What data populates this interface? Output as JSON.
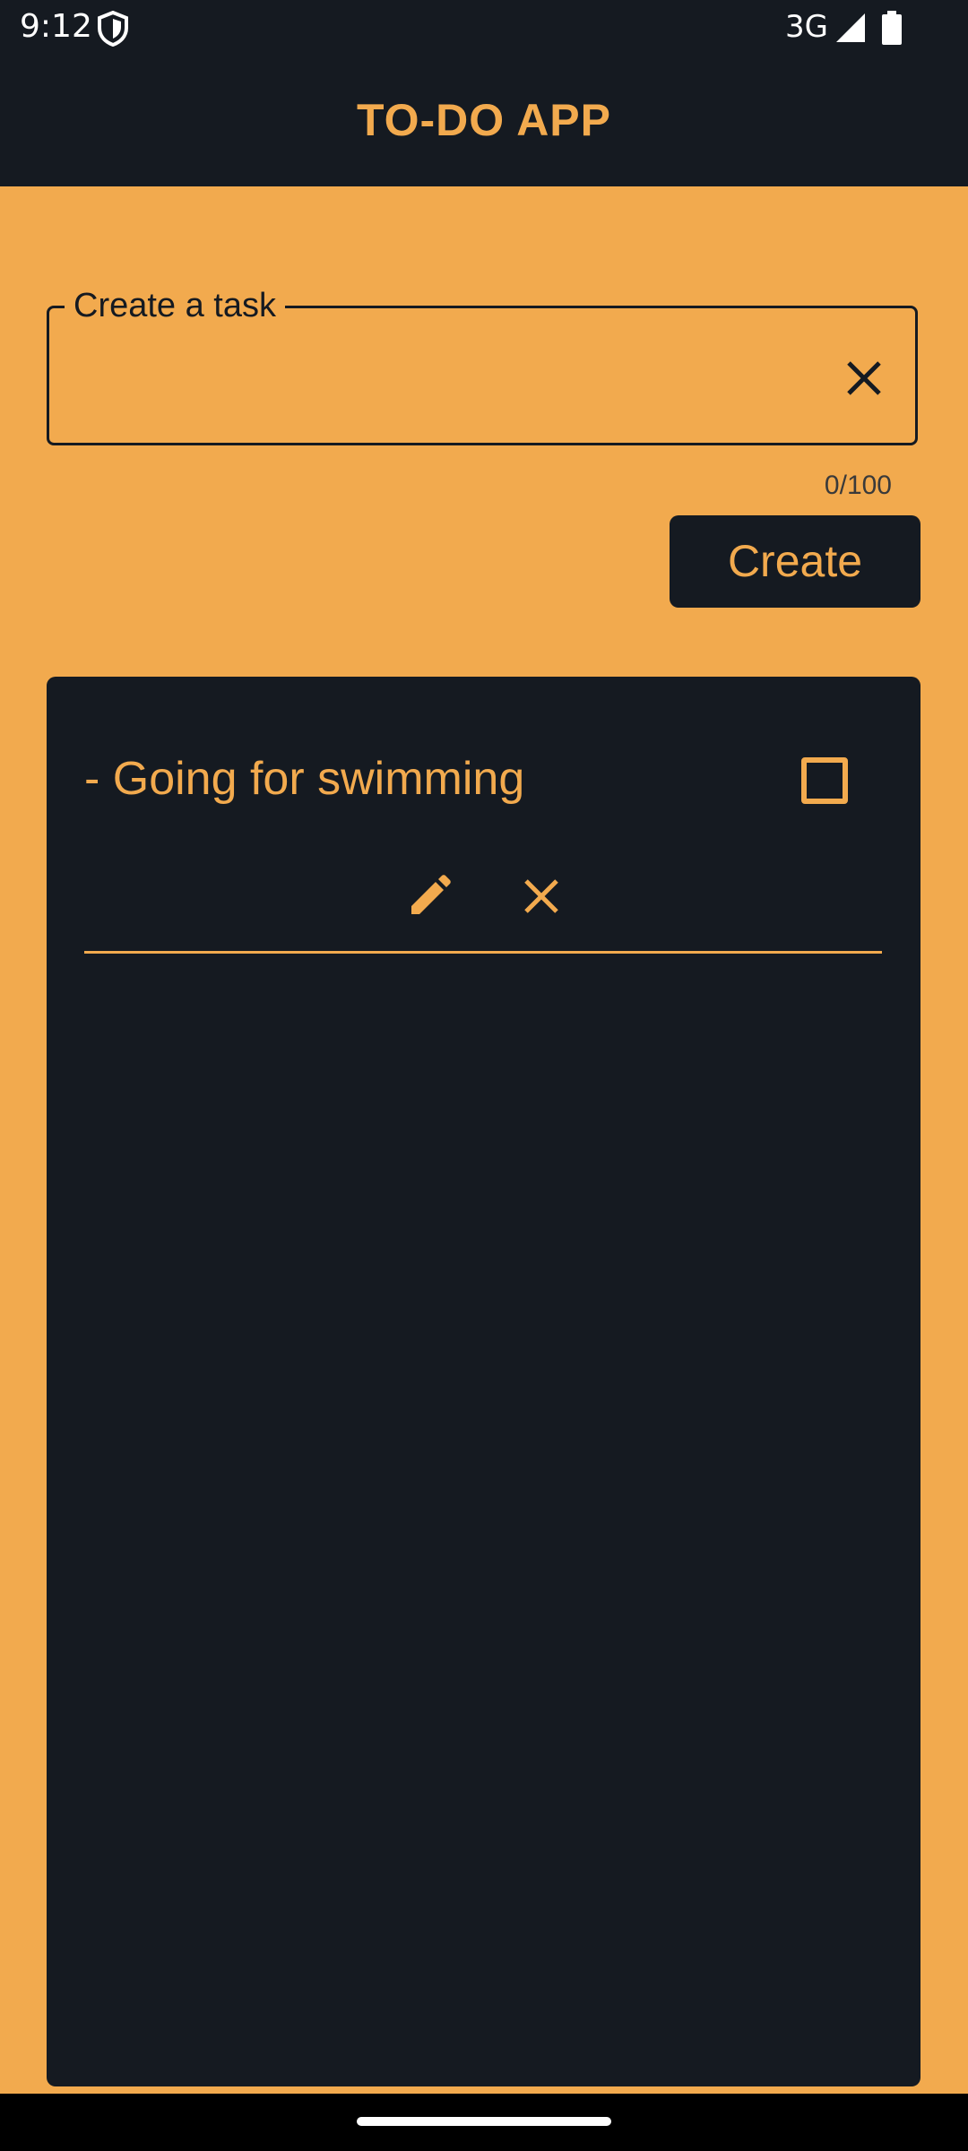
{
  "status_bar": {
    "time": "9:12",
    "network": "3G",
    "icons": [
      "shield-icon",
      "signal-icon",
      "battery-icon"
    ]
  },
  "app_bar": {
    "title": "TO-DO APP"
  },
  "task_form": {
    "label": "Create a task",
    "value": "",
    "counter": "0/100",
    "create_label": "Create",
    "clear_icon": "close-icon"
  },
  "tasks": [
    {
      "text": "- Going for swimming",
      "checked": false,
      "edit_icon": "pencil-icon",
      "delete_icon": "close-icon"
    }
  ],
  "colors": {
    "background": "#F2AA4E",
    "dark": "#151A21",
    "accent": "#F2AA4E"
  }
}
